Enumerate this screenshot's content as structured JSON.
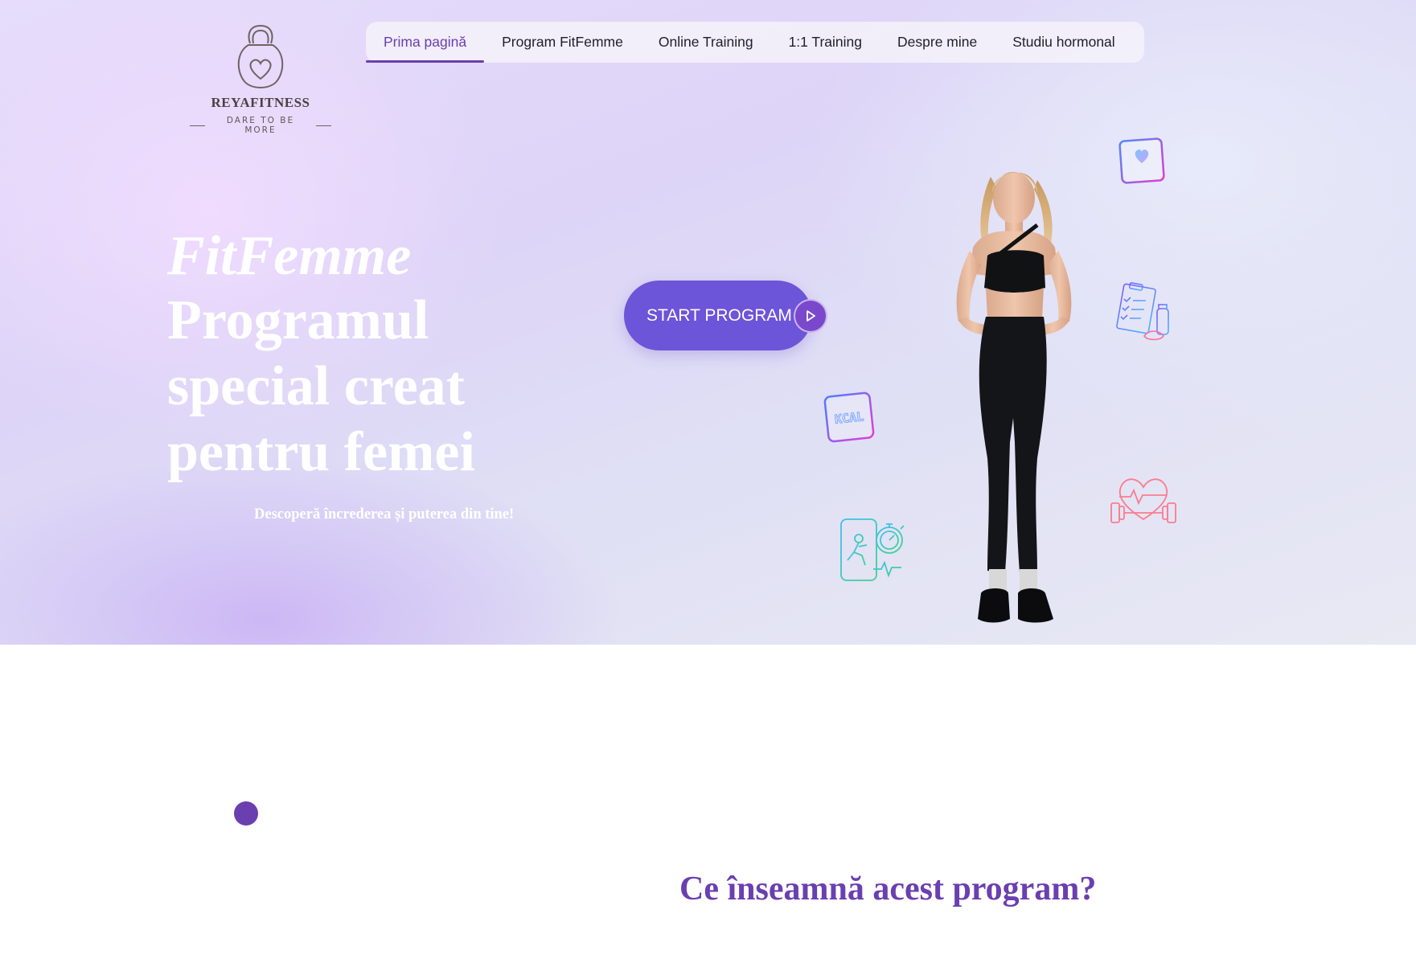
{
  "logo": {
    "name": "REYAFITNESS",
    "tagline": "DARE TO BE MORE"
  },
  "nav": {
    "items": [
      {
        "label": "Prima pagină",
        "active": true
      },
      {
        "label": "Program FitFemme",
        "active": false
      },
      {
        "label": "Online Training",
        "active": false
      },
      {
        "label": "1:1 Training",
        "active": false
      },
      {
        "label": "Despre mine",
        "active": false
      },
      {
        "label": "Studiu hormonal",
        "active": false
      }
    ]
  },
  "hero": {
    "brand": "FitFemme",
    "title_line1": "Programul",
    "title_line2": "special creat",
    "title_line3": "pentru femei",
    "subtitle": "Descoperă încrederea și puterea din tine!",
    "cta_label": "START PROGRAM",
    "icons": [
      "heart-app-icon",
      "checklist-nutrition-icon",
      "kcal-icon",
      "heart-dumbbell-icon",
      "phone-workout-timer-icon"
    ],
    "kcal_text": "KCAL"
  },
  "section": {
    "title": "Ce înseamnă acest program?"
  },
  "colors": {
    "accent": "#6a3fb0",
    "cta": "#6c55d8",
    "text_dark": "#1f1f2a"
  }
}
